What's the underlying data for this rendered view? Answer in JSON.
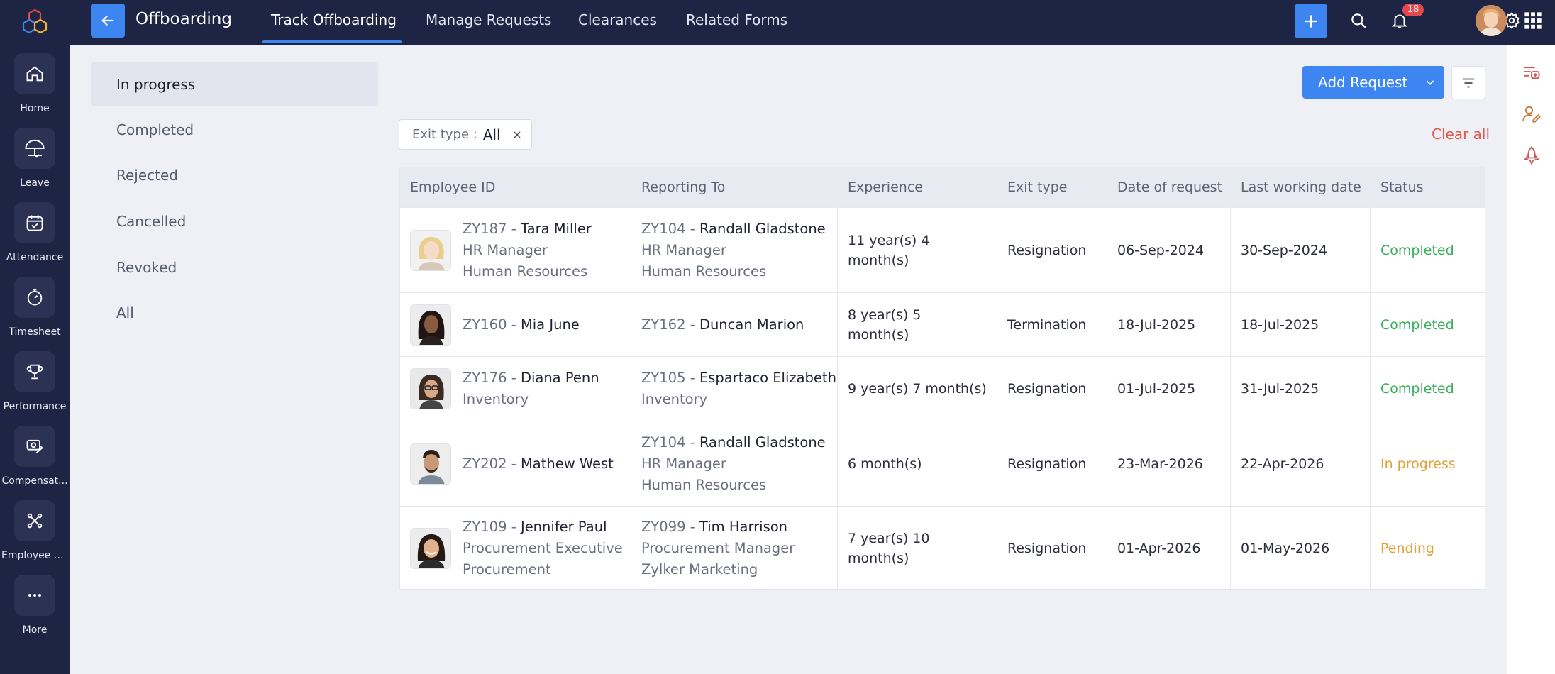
{
  "rail": {
    "items": [
      {
        "label": "Home",
        "icon": "home-icon"
      },
      {
        "label": "Leave",
        "icon": "umbrella-icon"
      },
      {
        "label": "Attendance",
        "icon": "calendar-check-icon"
      },
      {
        "label": "Timesheet",
        "icon": "stopwatch-icon"
      },
      {
        "label": "Performance",
        "icon": "trophy-icon"
      },
      {
        "label": "Compensat...",
        "icon": "compensation-icon"
      },
      {
        "label": "Employee E...",
        "icon": "engagement-icon"
      },
      {
        "label": "More",
        "icon": "more-dots-icon"
      }
    ]
  },
  "topbar": {
    "title": "Offboarding",
    "tabs": [
      {
        "label": "Track Offboarding"
      },
      {
        "label": "Manage Requests"
      },
      {
        "label": "Clearances"
      },
      {
        "label": "Related Forms"
      }
    ],
    "notification_count": "18"
  },
  "statuses": [
    {
      "label": "In progress"
    },
    {
      "label": "Completed"
    },
    {
      "label": "Rejected"
    },
    {
      "label": "Cancelled"
    },
    {
      "label": "Revoked"
    },
    {
      "label": "All"
    }
  ],
  "toolbar": {
    "add_request": "Add Request",
    "filter_key": "Exit type :",
    "filter_value": "All",
    "clear_all": "Clear all"
  },
  "table": {
    "columns": [
      "Employee ID",
      "Reporting To",
      "Experience",
      "Exit type",
      "Date of request",
      "Last working date",
      "Status"
    ],
    "rows": [
      {
        "emp_id": "ZY187",
        "emp_name": "Tara Miller",
        "emp_title": "HR Manager",
        "emp_dept": "Human Resources",
        "mgr_id": "ZY104",
        "mgr_name": "Randall Gladstone",
        "mgr_title": "HR Manager",
        "mgr_dept": "Human Resources",
        "exp1": "11 year(s) 4",
        "exp2": "month(s)",
        "exit": "Resignation",
        "req": "06-Sep-2024",
        "last": "30-Sep-2024",
        "status": "Completed"
      },
      {
        "emp_id": "ZY160",
        "emp_name": "Mia June",
        "emp_title": "",
        "emp_dept": "",
        "mgr_id": "ZY162",
        "mgr_name": "Duncan Marion",
        "mgr_title": "",
        "mgr_dept": "",
        "exp1": "8 year(s) 5",
        "exp2": "month(s)",
        "exit": "Termination",
        "req": "18-Jul-2025",
        "last": "18-Jul-2025",
        "status": "Completed"
      },
      {
        "emp_id": "ZY176",
        "emp_name": "Diana Penn",
        "emp_title": "Inventory",
        "emp_dept": "",
        "mgr_id": "ZY105",
        "mgr_name": "Espartaco Elizabeth",
        "mgr_title": "Inventory",
        "mgr_dept": "",
        "exp1": "9 year(s) 7 month(s)",
        "exp2": "",
        "exit": "Resignation",
        "req": "01-Jul-2025",
        "last": "31-Jul-2025",
        "status": "Completed"
      },
      {
        "emp_id": "ZY202",
        "emp_name": "Mathew West",
        "emp_title": "",
        "emp_dept": "",
        "mgr_id": "ZY104",
        "mgr_name": "Randall Gladstone",
        "mgr_title": "HR Manager",
        "mgr_dept": "Human Resources",
        "exp1": "6 month(s)",
        "exp2": "",
        "exit": "Resignation",
        "req": "23-Mar-2026",
        "last": "22-Apr-2026",
        "status": "In progress"
      },
      {
        "emp_id": "ZY109",
        "emp_name": "Jennifer Paul",
        "emp_title": "Procurement Executive",
        "emp_dept": "Procurement",
        "mgr_id": "ZY099",
        "mgr_name": "Tim Harrison",
        "mgr_title": "Procurement Manager",
        "mgr_dept": "Zylker Marketing",
        "exp1": "7 year(s) 10",
        "exp2": "month(s)",
        "exit": "Resignation",
        "req": "01-Apr-2026",
        "last": "01-May-2026",
        "status": "Pending"
      }
    ]
  },
  "colors": {
    "rail_bg": "#1e2444",
    "accent": "#3d86f2",
    "completed": "#3cae5c",
    "in_progress": "#e3a03a",
    "pending": "#e3a03a",
    "clear_all": "#e05a4f"
  }
}
